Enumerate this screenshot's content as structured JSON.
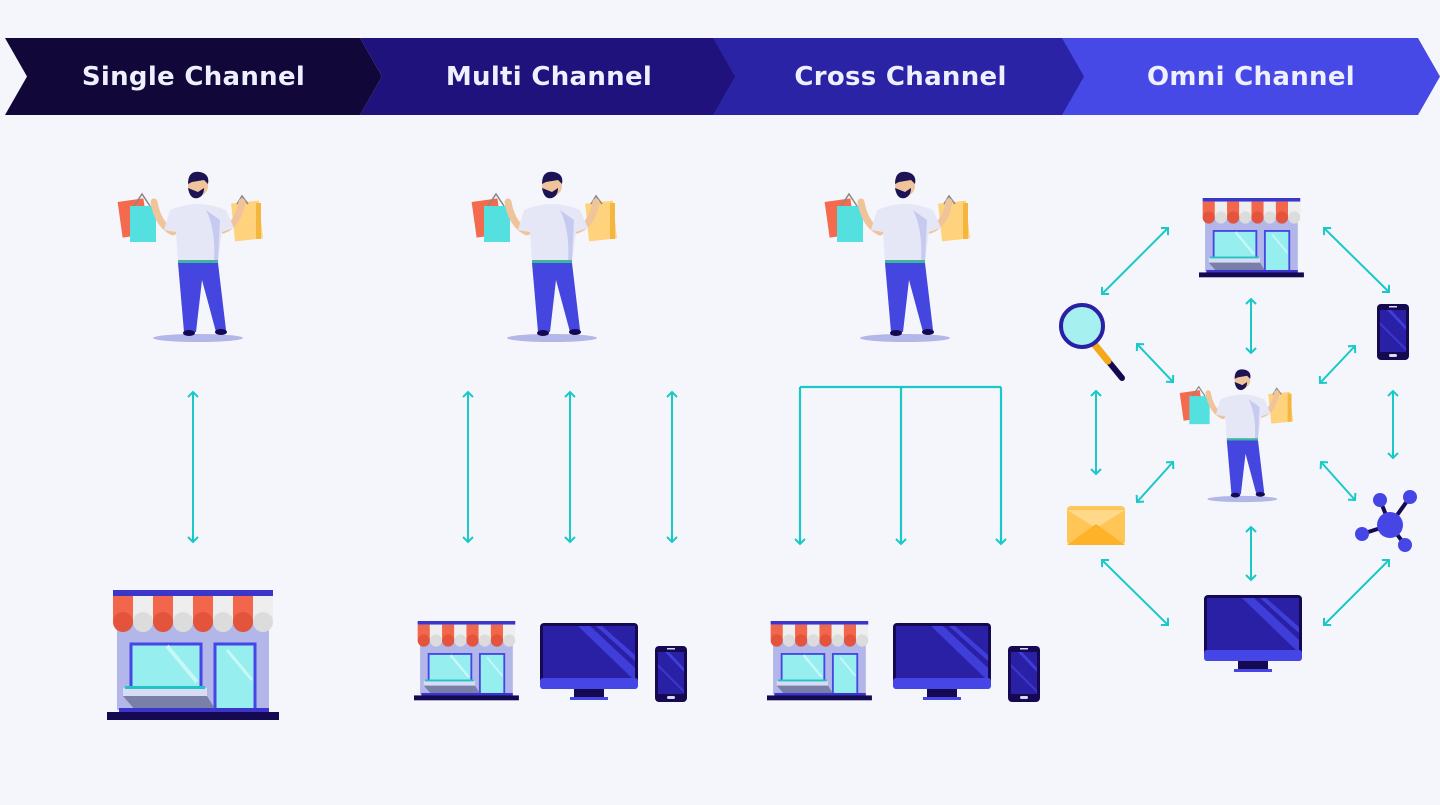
{
  "stages": [
    {
      "label": "Single Channel",
      "color": "#110739"
    },
    {
      "label": "Multi Channel",
      "color": "#1f127c"
    },
    {
      "label": "Cross Channel",
      "color": "#2b23a6"
    },
    {
      "label": "Omni Channel",
      "color": "#4649e6"
    }
  ],
  "colors": {
    "background": "#f5f6fb",
    "arrow": "#18c9c8",
    "pants": "#4545e0",
    "shirt": "#e6e7f6",
    "awning_red": "#f2674c",
    "awning_white": "#eeeeee",
    "store_wall": "#b2b6e8",
    "glass": "#96eeee",
    "screen": "#2a20a6",
    "screen_frame": "#4646e6",
    "dark_base": "#150a52",
    "envelope": "#ffc555",
    "bag_red": "#f46a4e",
    "bag_teal": "#55e0e0",
    "bag_yellow": "#ffd27e"
  },
  "sections": {
    "single": {
      "shopper": "shopper",
      "channels": [
        "store"
      ]
    },
    "multi": {
      "shopper": "shopper",
      "channels": [
        "store",
        "desktop",
        "mobile"
      ]
    },
    "cross": {
      "shopper": "shopper",
      "channels": [
        "store",
        "desktop",
        "mobile"
      ]
    },
    "omni": {
      "shopper": "shopper",
      "channels": [
        "store",
        "search",
        "mobile",
        "email",
        "network",
        "desktop"
      ]
    }
  }
}
